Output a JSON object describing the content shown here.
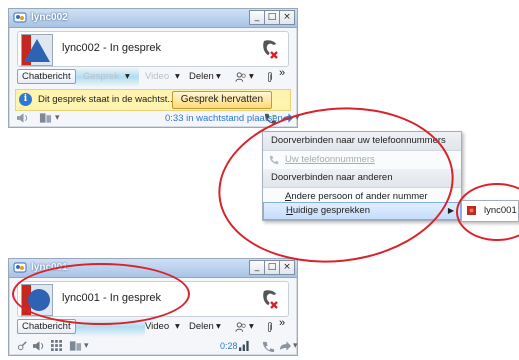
{
  "window1": {
    "title": "lync002",
    "controls": {
      "minimize": "_",
      "maximize": "□",
      "close": "×"
    },
    "contact_name": "lync002 - In gesprek",
    "toolbar": {
      "chat": "Chatbericht",
      "call": "Gesprek",
      "video": "Video",
      "share": "Delen",
      "more": "»"
    },
    "notice": {
      "text": "Dit gesprek staat in de wachtst...",
      "button": "Gesprek hervatten"
    },
    "status": {
      "hold_text": "0:33 in wachtstand plaatsen"
    }
  },
  "menu": {
    "header1": "Doorverbinden naar uw telefoonnummers",
    "item_phone": "Uw telefoonnummers",
    "header2": "Doorverbinden naar anderen",
    "item_other_underline": "A",
    "item_other_rest": "ndere persoon of ander nummer",
    "item_current_underline": "H",
    "item_current_rest": "uidige gesprekken",
    "submenu_item": "lync001"
  },
  "window2": {
    "title": "lync001",
    "controls": {
      "minimize": "_",
      "maximize": "□",
      "close": "×"
    },
    "contact_name": "lync001 - In gesprek",
    "toolbar": {
      "chat": "Chatbericht",
      "video": "Video",
      "share": "Delen",
      "more": "»"
    },
    "status": {
      "timer": "0:28"
    }
  },
  "colors": {
    "annotation": "#d9232b",
    "call_red": "#d93a2b",
    "accent_blue": "#2d78d2",
    "notice_bg": "#fff3b0"
  }
}
